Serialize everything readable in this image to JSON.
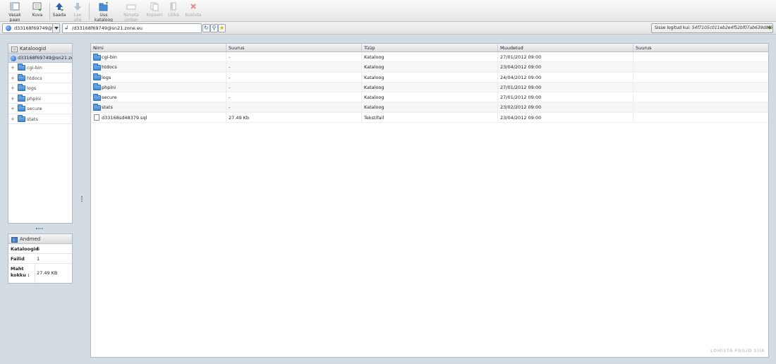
{
  "toolbar": {
    "buttons": [
      {
        "label": "Vasak paan",
        "icon": "left-pane-icon",
        "enabled": true
      },
      {
        "label": "Kuva",
        "icon": "view-icon",
        "enabled": true
      },
      {
        "label": "Saada",
        "icon": "upload-icon",
        "enabled": true
      },
      {
        "label": "Lae alla",
        "icon": "download-icon",
        "enabled": false
      },
      {
        "label": "Uus kataloog",
        "icon": "new-folder-icon",
        "enabled": true
      },
      {
        "label": "Nimeta ümber",
        "icon": "rename-icon",
        "enabled": false
      },
      {
        "label": "Kopeeri",
        "icon": "copy-icon",
        "enabled": false
      },
      {
        "label": "Lõika",
        "icon": "cut-icon",
        "enabled": false
      },
      {
        "label": "Kustuta",
        "icon": "delete-icon",
        "enabled": false
      }
    ]
  },
  "address": {
    "account": "d33168f69749@sn21.zone.eu",
    "path": "/d33168f69749@sn21.zone.eu",
    "hash_label": "Sisse logitud kui:",
    "hash_value": "54f7105c011eb2e4f52bf07ab639d8f6"
  },
  "tree": {
    "title": "Kataloogid",
    "root": "d33168f69749@sn21.zone.eu",
    "items": [
      "cgi-bin",
      "htdocs",
      "logs",
      "phpini",
      "secure",
      "stats"
    ]
  },
  "info": {
    "title": "Andmed",
    "rows": [
      {
        "key": "Kataloogid",
        "value": "6"
      },
      {
        "key": "Failid",
        "value": "1"
      },
      {
        "key": "Maht kokku :",
        "value": "27.49 KB"
      }
    ]
  },
  "grid": {
    "headers": [
      "Nimi",
      "Suurus",
      "Tüüp",
      "Muudetud",
      "Suurus"
    ],
    "rows": [
      {
        "name": "cgi-bin",
        "size": "-",
        "type": "Kataloog",
        "modified": "27/01/2012 09:00",
        "kind": "folder"
      },
      {
        "name": "htdocs",
        "size": "-",
        "type": "Kataloog",
        "modified": "23/04/2012 09:00",
        "kind": "folder"
      },
      {
        "name": "logs",
        "size": "-",
        "type": "Kataloog",
        "modified": "24/04/2012 09:00",
        "kind": "folder"
      },
      {
        "name": "phpini",
        "size": "-",
        "type": "Kataloog",
        "modified": "27/01/2012 09:00",
        "kind": "folder"
      },
      {
        "name": "secure",
        "size": "-",
        "type": "Kataloog",
        "modified": "27/01/2012 09:00",
        "kind": "folder"
      },
      {
        "name": "stats",
        "size": "-",
        "type": "Kataloog",
        "modified": "23/02/2012 09:00",
        "kind": "folder"
      },
      {
        "name": "d33168sd48379.sql",
        "size": "27.49 Kb",
        "type": "Tekstifail",
        "modified": "23/04/2012 09:00",
        "kind": "file"
      }
    ],
    "watermark": "LOHISTA FAILID SIIA"
  }
}
